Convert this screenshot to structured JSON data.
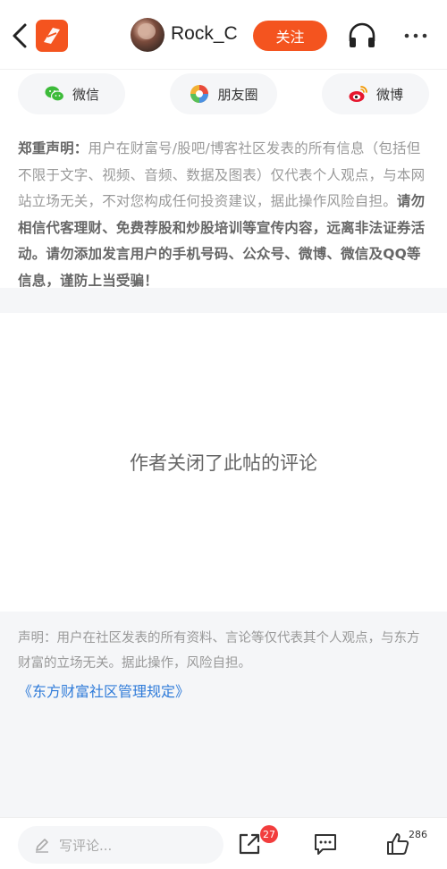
{
  "header": {
    "username": "Rock_C",
    "follow_label": "关注"
  },
  "share": {
    "wechat_label": "微信",
    "moments_label": "朋友圈",
    "weibo_label": "微博"
  },
  "disclaimer": {
    "title": "郑重声明：",
    "normal": "用户在财富号/股吧/博客社区发表的所有信息（包括但不限于文字、视频、音频、数据及图表）仅代表个人观点，与本网站立场无关，不对您构成任何投资建议，据此操作风险自担。",
    "bold": "请勿相信代客理财、免费荐股和炒股培训等宣传内容，远离非法证券活动。请勿添加发言用户的手机号码、公众号、微博、微信及QQ等信息，谨防上当受骗！"
  },
  "comments_closed": "作者关闭了此帖的评论",
  "statement": {
    "text": "声明：用户在社区发表的所有资料、言论等仅代表其个人观点，与东方财富的立场无关。据此操作，风险自担。",
    "rule_link": "《东方财富社区管理规定》"
  },
  "bottom_bar": {
    "comment_placeholder": "写评论...",
    "share_count": "27",
    "like_count": "286"
  },
  "colors": {
    "brand": "#f4541f",
    "link": "#2f7bd9",
    "badge": "#f23d3d"
  }
}
